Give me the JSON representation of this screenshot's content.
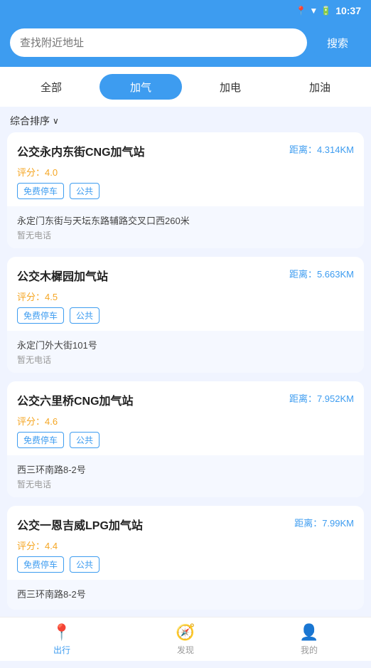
{
  "statusBar": {
    "time": "10:37"
  },
  "header": {
    "searchPlaceholder": "查找附近地址",
    "searchBtnLabel": "搜索"
  },
  "tabs": [
    {
      "id": "all",
      "label": "全部",
      "active": false
    },
    {
      "id": "gas",
      "label": "加气",
      "active": true
    },
    {
      "id": "electricity",
      "label": "加电",
      "active": false
    },
    {
      "id": "fuel",
      "label": "加油",
      "active": false
    }
  ],
  "sort": {
    "label": "综合排序",
    "arrow": "∨"
  },
  "stations": [
    {
      "id": 1,
      "name": "公交永内东街CNG加气站",
      "distance": "距离：4.314KM",
      "rating": "评分：4.0",
      "tags": [
        "免费停车",
        "公共"
      ],
      "address": "永定门东街与天坛东路辅路交叉口西260米",
      "phone": "暂无电话"
    },
    {
      "id": 2,
      "name": "公交木樨园加气站",
      "distance": "距离：5.663KM",
      "rating": "评分：4.5",
      "tags": [
        "免费停车",
        "公共"
      ],
      "address": "永定门外大街101号",
      "phone": "暂无电话"
    },
    {
      "id": 3,
      "name": "公交六里桥CNG加气站",
      "distance": "距离：7.952KM",
      "rating": "评分：4.6",
      "tags": [
        "免费停车",
        "公共"
      ],
      "address": "西三环南路8-2号",
      "phone": "暂无电话"
    },
    {
      "id": 4,
      "name": "公交一恩吉威LPG加气站",
      "distance": "距离：7.99KM",
      "rating": "评分：4.4",
      "tags": [
        "免费停车",
        "公共"
      ],
      "address": "西三环南路8-2号",
      "phone": ""
    }
  ],
  "bottomNav": [
    {
      "id": "travel",
      "label": "出行",
      "icon": "📍",
      "active": true
    },
    {
      "id": "discover",
      "label": "发现",
      "icon": "🧭",
      "active": false
    },
    {
      "id": "mine",
      "label": "我的",
      "icon": "👤",
      "active": false
    }
  ]
}
